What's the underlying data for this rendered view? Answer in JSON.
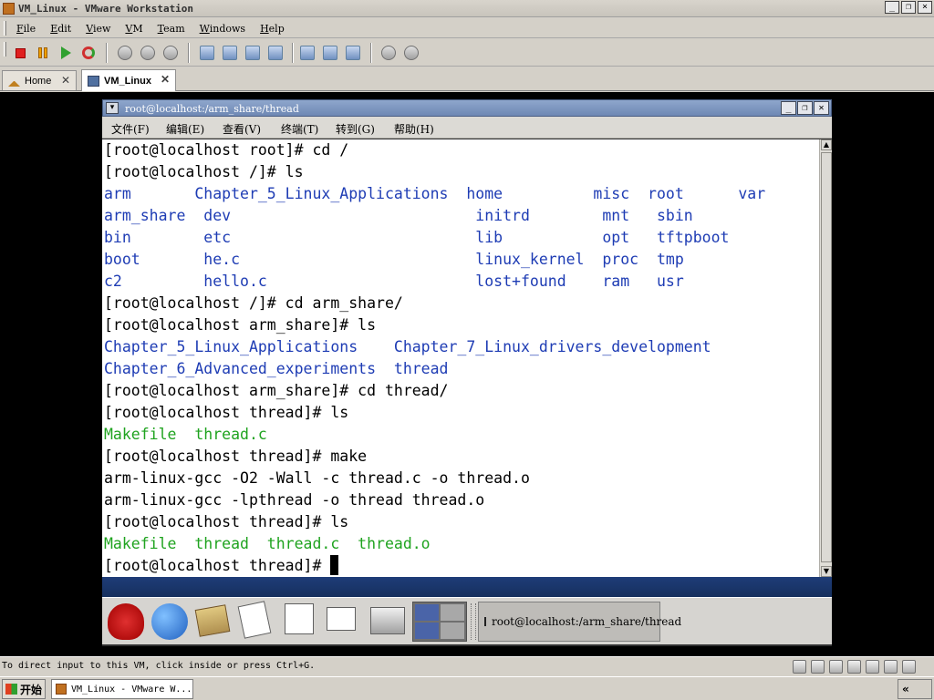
{
  "window": {
    "title": "VM_Linux - VMware Workstation"
  },
  "menubar": [
    "File",
    "Edit",
    "View",
    "VM",
    "Team",
    "Windows",
    "Help"
  ],
  "tabs": [
    {
      "label": "Home",
      "icon": "home-icon"
    },
    {
      "label": "VM_Linux",
      "icon": "vm-icon"
    }
  ],
  "guest_window": {
    "title": "root@localhost:/arm_share/thread",
    "menu": [
      "文件(F)",
      "编辑(E)",
      "查看(V)",
      "终端(T)",
      "转到(G)",
      "帮助(H)"
    ]
  },
  "terminal": {
    "colors": {
      "dir": "#1e3cb4",
      "exec": "#1fa31f",
      "text": "#000000"
    },
    "lines": [
      "[root@localhost root]# cd /",
      "[root@localhost /]# ls",
      "arm       Chapter_5_Linux_Applications  home          misc  root      var",
      "arm_share  dev                           initrd        mnt   sbin",
      "bin        etc                           lib           opt   tftpboot",
      "boot       he.c                          linux_kernel  proc  tmp",
      "c2         hello.c                       lost+found    ram   usr",
      "[root@localhost /]# cd arm_share/",
      "[root@localhost arm_share]# ls",
      "Chapter_5_Linux_Applications    Chapter_7_Linux_drivers_development",
      "Chapter_6_Advanced_experiments  thread",
      "[root@localhost arm_share]# cd thread/",
      "[root@localhost thread]# ls",
      "Makefile  thread.c",
      "[root@localhost thread]# make",
      "arm-linux-gcc -O2 -Wall -c thread.c -o thread.o",
      "arm-linux-gcc -lpthread -o thread thread.o",
      "[root@localhost thread]# ls",
      "Makefile  thread  thread.c  thread.o",
      "[root@localhost thread]# "
    ]
  },
  "guest_panel": {
    "task_label": "root@localhost:/arm_share/thread"
  },
  "statusbar": {
    "text": "To direct input to this VM, click inside or press Ctrl+G."
  },
  "taskbar": {
    "start_label": "开始",
    "task_label": "VM_Linux - VMware W..."
  }
}
